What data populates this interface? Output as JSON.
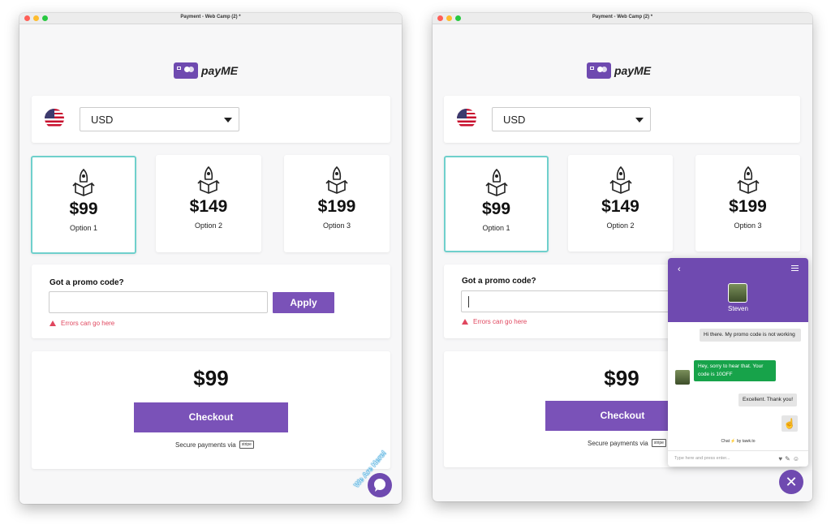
{
  "window": {
    "title": "Payment - Web Camp (2) *"
  },
  "brand": {
    "name": "payME"
  },
  "currency": {
    "selected": "USD"
  },
  "options": [
    {
      "price": "$99",
      "label": "Option 1",
      "selected": true
    },
    {
      "price": "$149",
      "label": "Option 2",
      "selected": false
    },
    {
      "price": "$199",
      "label": "Option 3",
      "selected": false
    }
  ],
  "promo": {
    "title": "Got a promo code?",
    "input_value": "",
    "apply_label": "Apply",
    "error": "Errors can go here"
  },
  "checkout": {
    "total": "$99",
    "button_label": "Checkout",
    "secure_text": "Secure payments via",
    "provider_badge": "stripe"
  },
  "widget": {
    "bubble_text": "We Are Here!"
  },
  "chat": {
    "agent_name": "Steven",
    "messages": [
      {
        "from": "visitor",
        "text": "Hi there. My promo code is not working"
      },
      {
        "from": "agent",
        "text": "Hey, sorry to hear that. Your code is 10OFF"
      },
      {
        "from": "visitor",
        "text": "Excellent. Thank you!"
      }
    ],
    "powered_by": "Chat ⚡ by tawk.to",
    "input_placeholder": "Type here and press enter..."
  },
  "colors": {
    "brand": "#6f4ab0",
    "button": "#7a52b8",
    "selected_border": "#6fd0cc",
    "error": "#e0465e",
    "agent_bubble": "#17a34a"
  }
}
